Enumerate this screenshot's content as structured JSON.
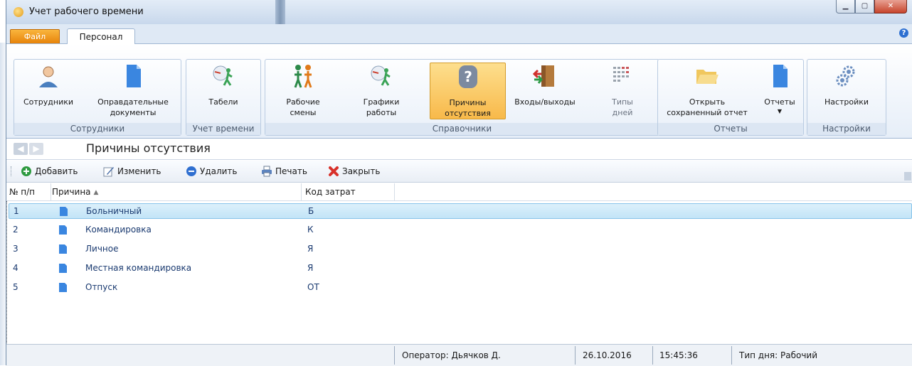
{
  "window": {
    "title": "Учет рабочего времени"
  },
  "tabs": {
    "file": "Файл",
    "personal": "Персонал"
  },
  "ribbon": {
    "groups": [
      {
        "label": "Сотрудники",
        "buttons": [
          {
            "label": "Сотрудники",
            "icon": "employee-icon"
          },
          {
            "label": "Оправдательные\nдокументы",
            "icon": "document-icon"
          }
        ]
      },
      {
        "label": "Учет времени",
        "buttons": [
          {
            "label": "Табели",
            "icon": "timesheet-icon"
          }
        ]
      },
      {
        "label": "Справочники",
        "buttons": [
          {
            "label": "Рабочие\nсмены",
            "icon": "shifts-icon"
          },
          {
            "label": "Графики\nработы",
            "icon": "schedule-icon"
          },
          {
            "label": "Причины\nотсутствия",
            "icon": "question-person-icon",
            "active": true
          },
          {
            "label": "Входы/выходы",
            "icon": "door-icon"
          },
          {
            "label": "Типы\nдней",
            "icon": "calendar-grid-icon"
          }
        ]
      },
      {
        "label": "Отчеты",
        "buttons": [
          {
            "label": "Открыть\nсохраненный отчет",
            "icon": "folder-open-icon"
          },
          {
            "label": "Отчеты",
            "icon": "report-icon"
          }
        ]
      },
      {
        "label": "Настройки",
        "buttons": [
          {
            "label": "Настройки",
            "icon": "gears-icon"
          }
        ]
      }
    ]
  },
  "nav": {
    "title": "Причины отсутствия"
  },
  "toolbar": {
    "add": "Добавить",
    "edit": "Изменить",
    "delete": "Удалить",
    "print": "Печать",
    "close": "Закрыть"
  },
  "grid": {
    "columns": {
      "num": "№ п/п",
      "reason": "Причина",
      "code": "Код затрат"
    },
    "rows": [
      {
        "num": "1",
        "name": "Больничный",
        "code": "Б"
      },
      {
        "num": "2",
        "name": "Командировка",
        "code": "К"
      },
      {
        "num": "3",
        "name": "Личное",
        "code": "Я"
      },
      {
        "num": "4",
        "name": "Местная командировка",
        "code": "Я"
      },
      {
        "num": "5",
        "name": "Отпуск",
        "code": "ОТ"
      }
    ],
    "selected_row": 1
  },
  "status": {
    "operator": "Оператор:  Дьячков Д.",
    "date": "26.10.2016",
    "time": "15:45:36",
    "daytype": "Тип дня:  Рабочий"
  },
  "colors": {
    "accent_orange": "#f29a1f",
    "selection": "#c2e4f7",
    "link_text": "#1a3a70"
  }
}
